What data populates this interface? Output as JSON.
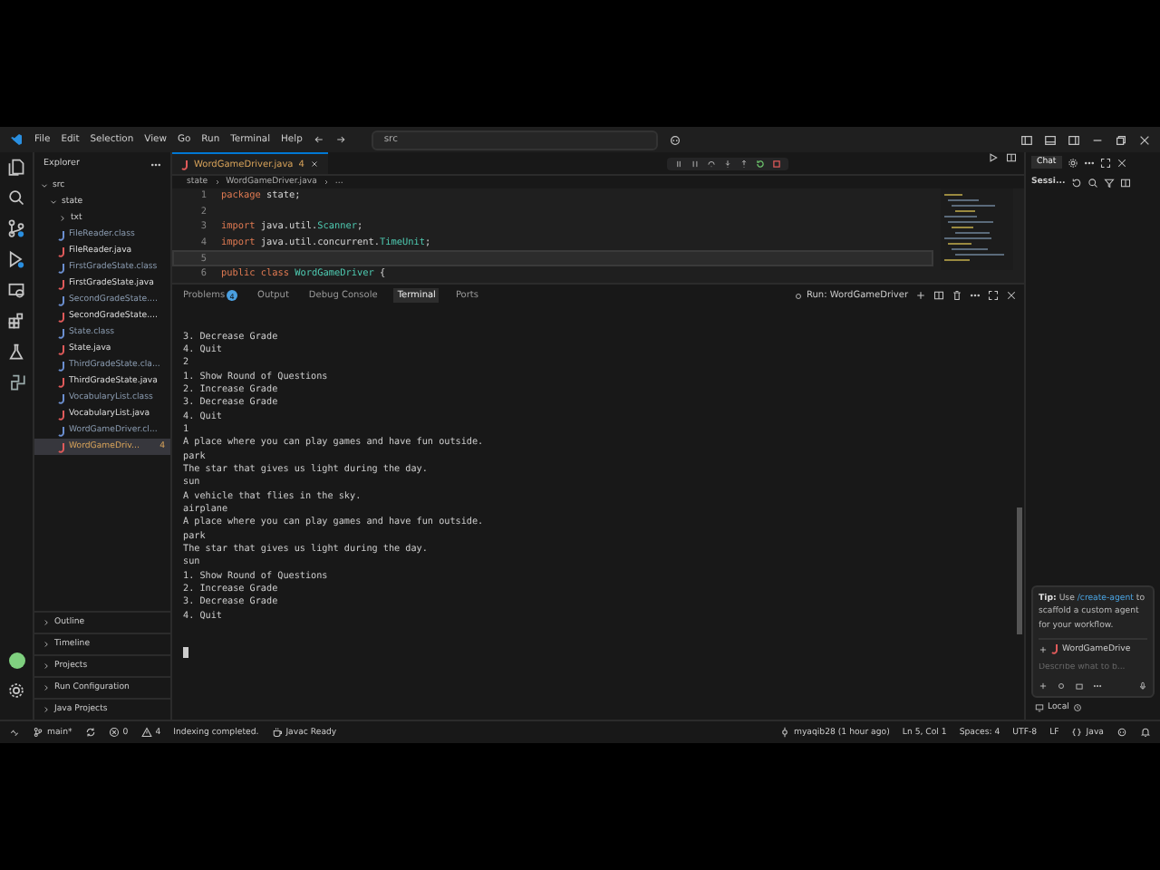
{
  "window": {
    "menu": [
      "File",
      "Edit",
      "Selection",
      "View",
      "Go",
      "Run",
      "Terminal",
      "Help"
    ],
    "search": "src"
  },
  "explorer": {
    "title": "Explorer",
    "tree": [
      {
        "label": "src",
        "kind": "folder",
        "expanded": true,
        "selected": false,
        "children": [
          {
            "label": "state",
            "kind": "folder",
            "expanded": true,
            "selected": false,
            "children": [
              {
                "label": "txt",
                "kind": "folder",
                "expanded": false,
                "selected": false
              },
              {
                "label": "FileReader.class",
                "kind": "class",
                "selected": false
              },
              {
                "label": "FileReader.java",
                "kind": "java",
                "selected": false
              },
              {
                "label": "FirstGradeState.class",
                "kind": "class",
                "selected": false
              },
              {
                "label": "FirstGradeState.java",
                "kind": "java",
                "selected": false
              },
              {
                "label": "SecondGradeState....",
                "kind": "class",
                "selected": false
              },
              {
                "label": "SecondGradeState....",
                "kind": "java",
                "selected": false
              },
              {
                "label": "State.class",
                "kind": "class",
                "selected": false
              },
              {
                "label": "State.java",
                "kind": "java",
                "selected": false
              },
              {
                "label": "ThirdGradeState.cla...",
                "kind": "class",
                "selected": false
              },
              {
                "label": "ThirdGradeState.java",
                "kind": "java",
                "selected": false
              },
              {
                "label": "VocabularyList.class",
                "kind": "class",
                "selected": false
              },
              {
                "label": "VocabularyList.java",
                "kind": "java",
                "selected": false
              },
              {
                "label": "WordGameDriver.cl...",
                "kind": "class",
                "selected": false
              },
              {
                "label": "WordGameDriv...",
                "kind": "java",
                "selected": true,
                "badge": "4"
              }
            ]
          }
        ]
      }
    ],
    "sections": [
      "Outline",
      "Timeline",
      "Projects",
      "Run Configuration",
      "Java Projects"
    ]
  },
  "editor": {
    "tabs": [
      {
        "label": "WordGameDriver.java",
        "badge": "4",
        "selected": true
      }
    ],
    "breadcrumbs": [
      "state",
      "WordGameDriver.java",
      "..."
    ],
    "lines": [
      {
        "number": "1",
        "current": false,
        "tokens": [
          {
            "text": "package",
            "kind": "keyword"
          },
          {
            "text": " state;",
            "kind": "plain"
          }
        ]
      },
      {
        "number": "2",
        "current": false
      },
      {
        "number": "3",
        "current": false,
        "tokens": [
          {
            "text": "import",
            "kind": "keyword"
          },
          {
            "text": " java.util.",
            "kind": "plain"
          },
          {
            "text": "Scanner",
            "kind": "type"
          },
          {
            "text": ";",
            "kind": "plain"
          }
        ]
      },
      {
        "number": "4",
        "current": false,
        "tokens": [
          {
            "text": "import",
            "kind": "keyword"
          },
          {
            "text": " java.util.concurrent.",
            "kind": "plain"
          },
          {
            "text": "TimeUnit",
            "kind": "type"
          },
          {
            "text": ";",
            "kind": "plain"
          }
        ]
      },
      {
        "number": "5",
        "current": true
      },
      {
        "number": "6",
        "current": false,
        "tokens": [
          {
            "text": "public class",
            "kind": "keyword"
          },
          {
            "text": " WordGameDriver",
            "kind": "type"
          },
          {
            "text": " {",
            "kind": "plain"
          }
        ]
      }
    ]
  },
  "panel": {
    "tabs": [
      {
        "label": "Problems",
        "badge": "4",
        "selected": false
      },
      {
        "label": "Output",
        "selected": false
      },
      {
        "label": "Debug Console",
        "selected": false
      },
      {
        "label": "Terminal",
        "selected": true
      },
      {
        "label": "Ports",
        "selected": false
      }
    ],
    "run_label": "Run: WordGameDriver",
    "terminal": [
      "3. Decrease Grade",
      "4. Quit",
      "2",
      "1. Show Round of Questions",
      "2. Increase Grade",
      "3. Decrease Grade",
      "4. Quit",
      "1",
      "A place where you can play games and have fun outside.",
      "park",
      "The star that gives us light during the day.",
      "sun",
      "A vehicle that flies in the sky.",
      "airplane",
      "A place where you can play games and have fun outside.",
      "park",
      "The star that gives us light during the day.",
      "sun",
      "1. Show Round of Questions",
      "2. Increase Grade",
      "3. Decrease Grade",
      "4. Quit"
    ]
  },
  "chat": {
    "tab": "Chat",
    "session": "Sessi...",
    "tip": {
      "label": "Tip:",
      "before": "Use",
      "link": "/create-agent",
      "after": "to scaffold a custom agent for your workflow."
    },
    "attachment": "WordGameDrive",
    "placeholder": "Describe what to b...",
    "mode": "Local"
  },
  "status_bar": {
    "left": [
      {
        "kind": "branch",
        "text": "main*"
      },
      {
        "kind": "sync"
      },
      {
        "kind": "errors",
        "text": "0"
      },
      {
        "kind": "warnings",
        "text": "4"
      },
      {
        "kind": "text",
        "text": "Indexing completed."
      },
      {
        "kind": "javac",
        "text": "Javac Ready"
      }
    ],
    "right": [
      {
        "kind": "commit",
        "text": "myaqib28 (1 hour ago)"
      },
      {
        "kind": "text",
        "text": "Ln 5, Col 1"
      },
      {
        "kind": "text",
        "text": "Spaces: 4"
      },
      {
        "kind": "text",
        "text": "UTF-8"
      },
      {
        "kind": "text",
        "text": "LF"
      },
      {
        "kind": "java",
        "text": "Java"
      }
    ]
  }
}
